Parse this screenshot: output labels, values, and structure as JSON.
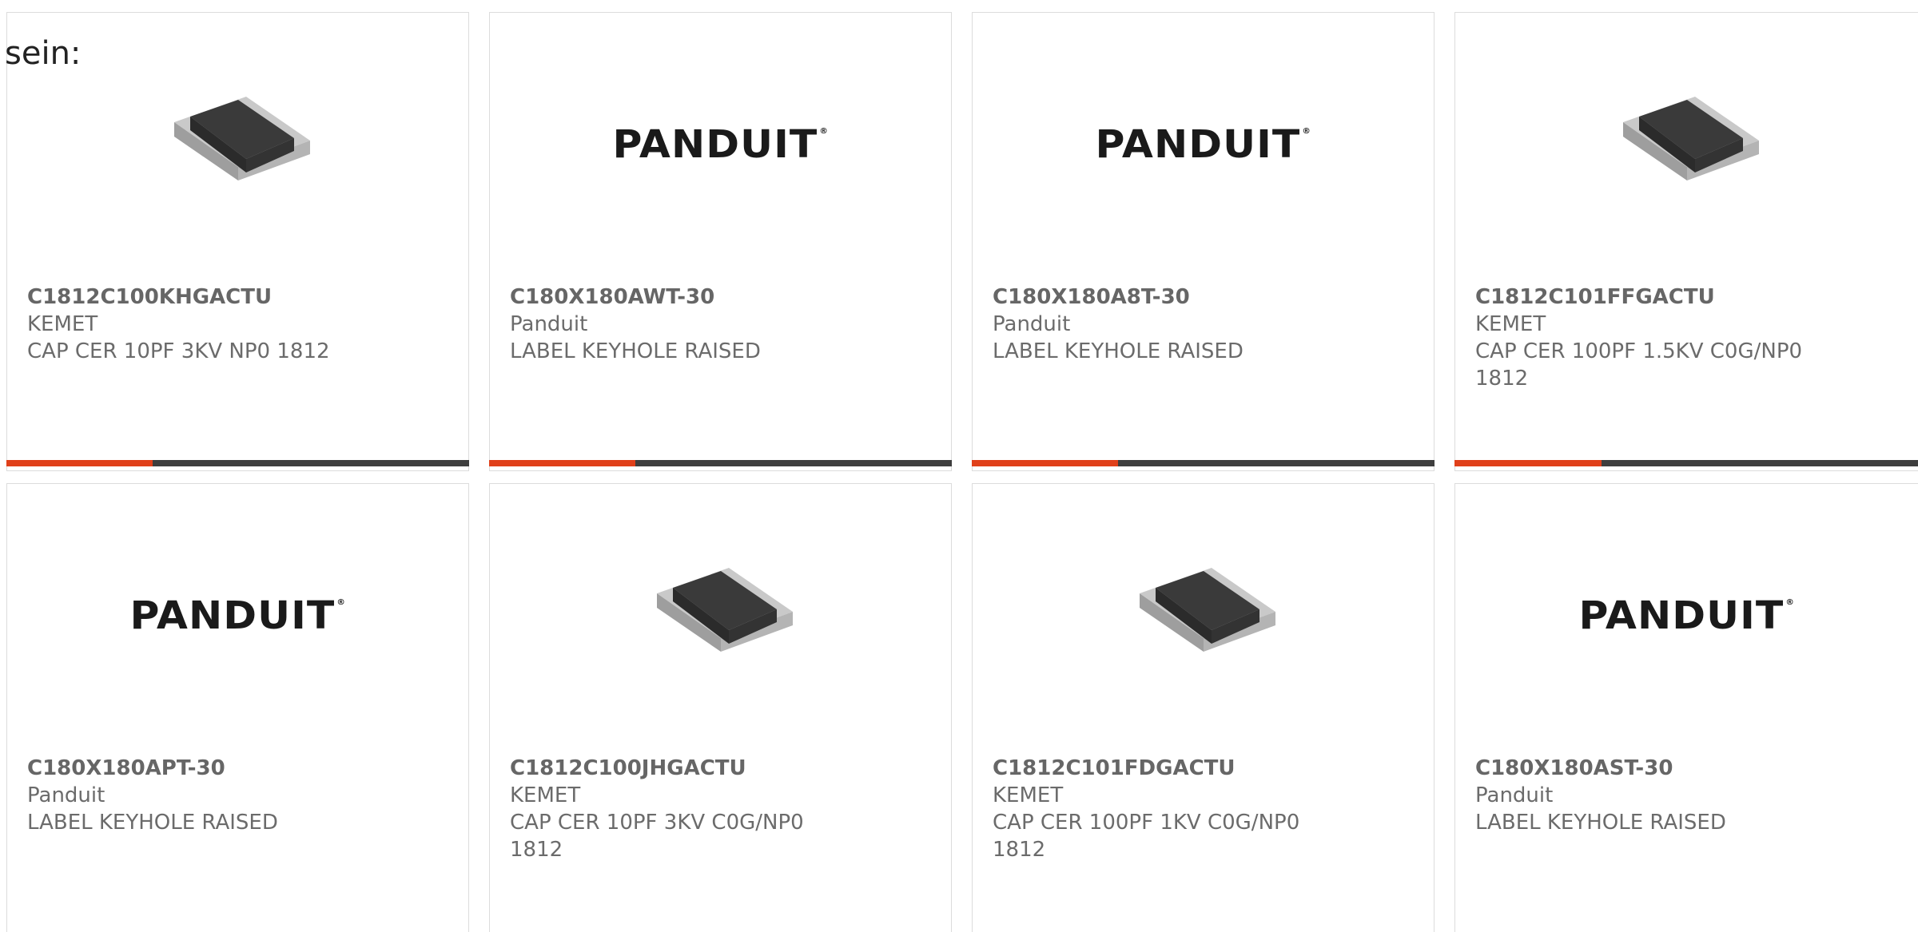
{
  "overlay_text": "sein:",
  "colors": {
    "accent": "#e0401a",
    "bar_dark": "#3e3e3e",
    "border": "#dcdcdc",
    "text_gray": "#6b6b6b"
  },
  "cards": [
    {
      "part_number": "C1812C100KHGACTU",
      "manufacturer": "KEMET",
      "description": "CAP CER 10PF 3KV NP0 1812",
      "image": "capacitor-chip-icon",
      "progress": 0.316
    },
    {
      "part_number": "C180X180AWT-30",
      "manufacturer": "Panduit",
      "description": "LABEL KEYHOLE RAISED",
      "image": "panduit-logo",
      "logo_text": "PANDUIT",
      "progress": 0.316
    },
    {
      "part_number": "C180X180A8T-30",
      "manufacturer": "Panduit",
      "description": "LABEL KEYHOLE RAISED",
      "image": "panduit-logo",
      "logo_text": "PANDUIT",
      "progress": 0.316
    },
    {
      "part_number": "C1812C101FFGACTU",
      "manufacturer": "KEMET",
      "description": "CAP CER 100PF 1.5KV C0G/NP0 1812",
      "image": "capacitor-chip-icon",
      "progress": 0.316
    },
    {
      "part_number": "C180X180APT-30",
      "manufacturer": "Panduit",
      "description": "LABEL KEYHOLE RAISED",
      "image": "panduit-logo",
      "logo_text": "PANDUIT"
    },
    {
      "part_number": "C1812C100JHGACTU",
      "manufacturer": "KEMET",
      "description": "CAP CER 10PF 3KV C0G/NP0 1812",
      "image": "capacitor-chip-icon"
    },
    {
      "part_number": "C1812C101FDGACTU",
      "manufacturer": "KEMET",
      "description": "CAP CER 100PF 1KV C0G/NP0 1812",
      "image": "capacitor-chip-icon"
    },
    {
      "part_number": "C180X180AST-30",
      "manufacturer": "Panduit",
      "description": "LABEL KEYHOLE RAISED",
      "image": "panduit-logo",
      "logo_text": "PANDUIT"
    }
  ]
}
